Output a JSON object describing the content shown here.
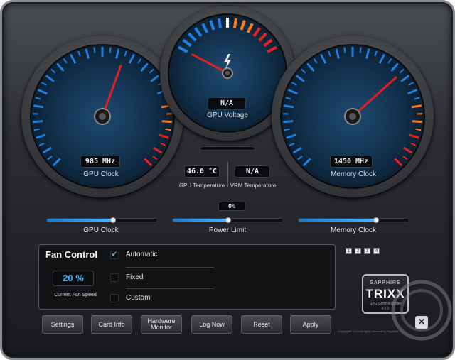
{
  "gauges": {
    "gpu_clock": {
      "value": "985 MHz",
      "label": "GPU Clock"
    },
    "voltage": {
      "value": "N/A",
      "label": "GPU Voltage",
      "icon": "lightning-icon"
    },
    "memory_clock": {
      "value": "1450 MHz",
      "label": "Memory Clock"
    }
  },
  "readouts": {
    "gpu_temp": {
      "value": "46.0 °C",
      "label": "GPU Temperature"
    },
    "vrm_temp": {
      "value": "N/A",
      "label": "VRM Temperature"
    },
    "power_pct": "0%"
  },
  "sliders": {
    "gpu_clock": {
      "label": "GPU Clock",
      "level": 0.6
    },
    "power_limit": {
      "label": "Power Limit",
      "level": 0.5
    },
    "memory_clock": {
      "label": "Memory Clock",
      "level": 0.7
    }
  },
  "fan_control": {
    "title": "Fan Control",
    "speed": "20 %",
    "speed_label": "Current Fan Speed",
    "options": [
      {
        "label": "Automatic",
        "checked": true
      },
      {
        "label": "Fixed",
        "checked": false
      },
      {
        "label": "Custom",
        "checked": false
      }
    ]
  },
  "profiles": [
    "1",
    "2",
    "3",
    "4"
  ],
  "buttons": {
    "settings": "Settings",
    "card_info": "Card Info",
    "hardware_monitor_line1": "Hardware",
    "hardware_monitor_line2": "Monitor",
    "log_now": "Log Now",
    "reset": "Reset",
    "apply": "Apply"
  },
  "logo": {
    "brand": "SAPPHIRE",
    "product": "TRIXX",
    "subtitle": "GPU Control Center",
    "version": "4.6.0"
  },
  "copyright": "Copyright© 2013 All rights reserved by Sapphire",
  "close_glyph": "✕",
  "colors": {
    "accent": "#38b7ff",
    "needle": "#e02020"
  }
}
